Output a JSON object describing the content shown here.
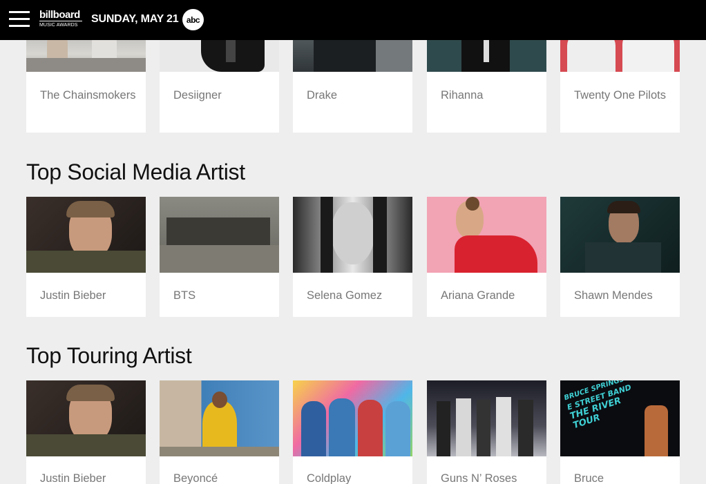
{
  "header": {
    "logo_line1": "billboard",
    "logo_line2": "MUSIC AWARDS",
    "date": "SUNDAY, MAY 21",
    "network": "abc"
  },
  "section0": {
    "cards": [
      {
        "name": "The Chainsmokers"
      },
      {
        "name": "Desiigner"
      },
      {
        "name": "Drake"
      },
      {
        "name": "Rihanna"
      },
      {
        "name": "Twenty One Pilots"
      }
    ]
  },
  "section1": {
    "title": "Top Social Media Artist",
    "cards": [
      {
        "name": "Justin Bieber"
      },
      {
        "name": "BTS"
      },
      {
        "name": "Selena Gomez"
      },
      {
        "name": "Ariana Grande"
      },
      {
        "name": "Shawn Mendes"
      }
    ]
  },
  "section2": {
    "title": "Top Touring Artist",
    "cards": [
      {
        "name": "Justin Bieber"
      },
      {
        "name": "Beyoncé"
      },
      {
        "name": "Coldplay"
      },
      {
        "name": "Guns N’ Roses"
      },
      {
        "name": "Bruce"
      }
    ]
  },
  "poster_text": {
    "line1": "BRUCE SPRINGSTEEN",
    "line2": "E STREET BAND",
    "line3": "THE RIVER TOUR"
  }
}
